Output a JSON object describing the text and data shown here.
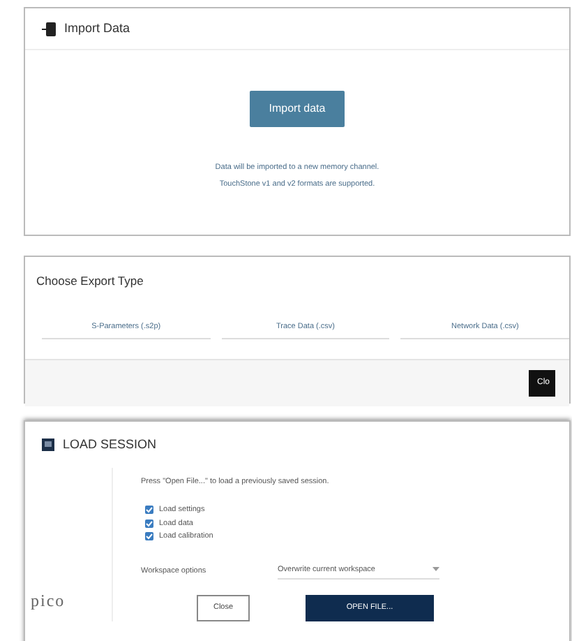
{
  "import_panel": {
    "title": "Import Data",
    "button": "Import data",
    "notes": [
      "Data will be imported to a new memory channel.",
      "TouchStone v1 and v2 formats are supported."
    ]
  },
  "export_panel": {
    "title": "Choose Export Type",
    "options": [
      {
        "label": "S-Parameters (.s2p)"
      },
      {
        "label": "Trace Data (.csv)"
      },
      {
        "label": "Network Data (.csv)"
      }
    ],
    "footer_button": "Clo"
  },
  "session_panel": {
    "title": "LOAD SESSION",
    "instruction": "Press \"Open File...\" to load a previously saved session.",
    "checkboxes": [
      {
        "label": "Load settings",
        "checked": true
      },
      {
        "label": "Load data",
        "checked": true
      },
      {
        "label": "Load calibration",
        "checked": true
      }
    ],
    "workspace_label": "Workspace options",
    "workspace_value": "Overwrite current workspace",
    "logo": "pico",
    "buttons": [
      {
        "label": "Close",
        "kind": "secondary"
      },
      {
        "label": "OPEN FILE...",
        "kind": "primary"
      }
    ]
  }
}
